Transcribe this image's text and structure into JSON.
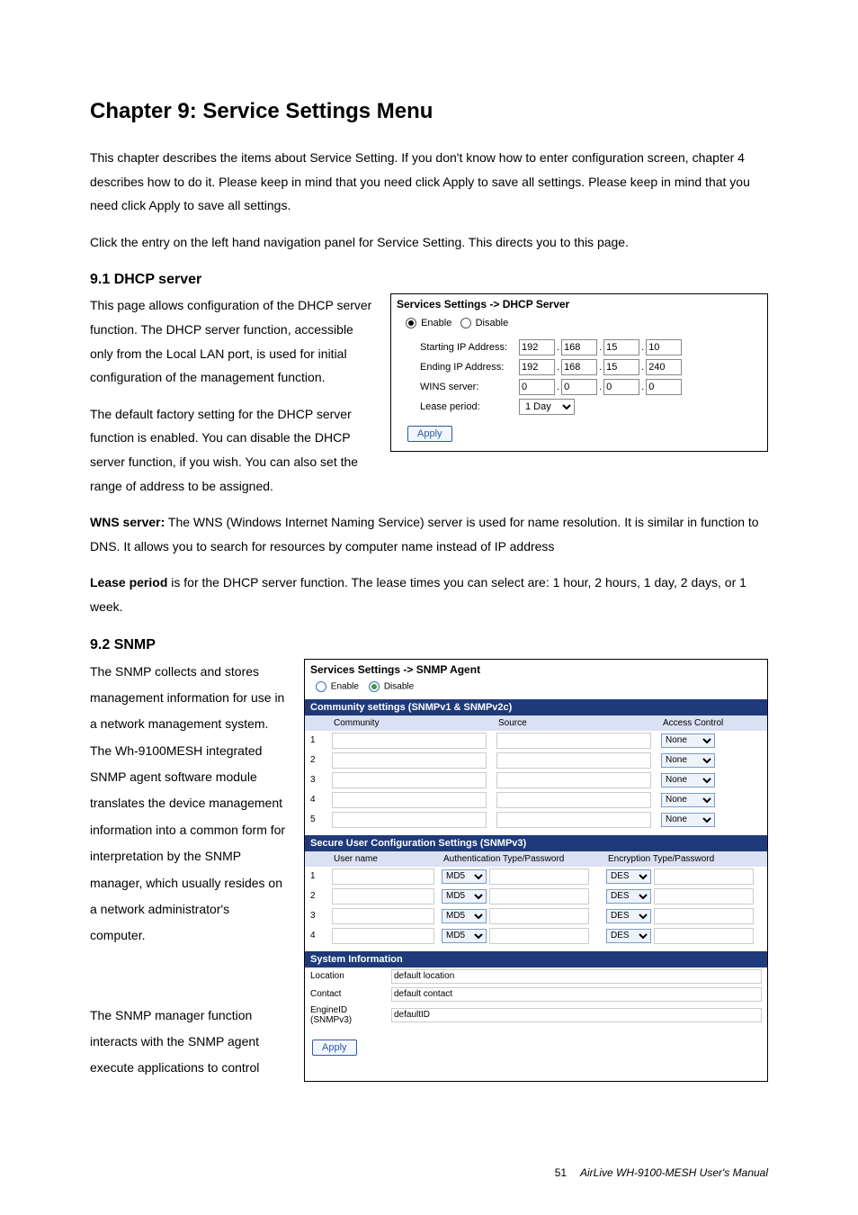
{
  "chapter_title": "Chapter 9: Service Settings Menu",
  "intro1": "This chapter describes the items about Service Setting. If you don't know how to enter configuration screen, chapter 4 describes how to do it. Please keep in mind that you need click Apply to save all settings. Please keep in mind that you need click Apply to save all settings.",
  "intro2": "Click the entry on the left hand navigation panel for Service Setting. This directs you to this page.",
  "section91_title": "9.1 DHCP server",
  "section91_p1": "This page allows configuration of the DHCP server function. The DHCP server function, accessible only from the Local LAN port, is used for initial configuration of the management function.",
  "section91_p2": "The default factory setting for the DHCP server function is enabled. You can disable the DHCP server function, if you wish. You can also set the range of address to be assigned.",
  "wns_bold": "WNS server:",
  "wns_text": " The WNS (Windows Internet Naming Service) server is used for name resolution. It is similar in function to DNS. It allows you to search for resources by computer name instead of IP address",
  "lease_bold": "Lease period",
  "lease_text": " is for the DHCP server function. The lease times you can select are: 1 hour, 2 hours, 1 day, 2 days, or 1 week.",
  "section92_title": "9.2 SNMP",
  "section92_p1": "The SNMP collects and stores management information for use in a network management system. The Wh-9100MESH integrated SNMP agent software module translates the device management information into a common form for interpretation by the SNMP manager, which usually resides on a network administrator's computer.",
  "section92_p2": "The SNMP manager function interacts with the SNMP agent execute applications to control",
  "dhcp_panel": {
    "title": "Services Settings -> DHCP Server",
    "enable": "Enable",
    "disable": "Disable",
    "starting_label": "Starting IP Address:",
    "ending_label": "Ending IP Address:",
    "wins_label": "WINS server:",
    "lease_label": "Lease period:",
    "starting_ip": [
      "192",
      "168",
      "15",
      "10"
    ],
    "ending_ip": [
      "192",
      "168",
      "15",
      "240"
    ],
    "wins_ip": [
      "0",
      "0",
      "0",
      "0"
    ],
    "lease_value": "1 Day",
    "apply": "Apply"
  },
  "snmp_panel": {
    "title": "Services Settings -> SNMP Agent",
    "enable": "Enable",
    "disable": "Disable",
    "community_header": "Community settings (SNMPv1 & SNMPv2c)",
    "cols_community": {
      "c1": "Community",
      "c2": "Source",
      "c3": "Access Control"
    },
    "access_default": "None",
    "rows5": [
      "1",
      "2",
      "3",
      "4",
      "5"
    ],
    "secure_header": "Secure User Configuration Settings (SNMPv3)",
    "cols_secure": {
      "c1": "User name",
      "c2": "Authentication Type/Password",
      "c3": "Encryption Type/Password"
    },
    "auth_default": "MD5",
    "enc_default": "DES",
    "rows4": [
      "1",
      "2",
      "3",
      "4"
    ],
    "sysinfo_header": "System Information",
    "location_label": "Location",
    "contact_label": "Contact",
    "engine_label": "EngineID (SNMPv3)",
    "location_value": "default location",
    "contact_value": "default contact",
    "engine_value": "defaultID",
    "apply": "Apply"
  },
  "footer": {
    "page": "51",
    "manual": "AirLive WH-9100-MESH  User's Manual"
  }
}
